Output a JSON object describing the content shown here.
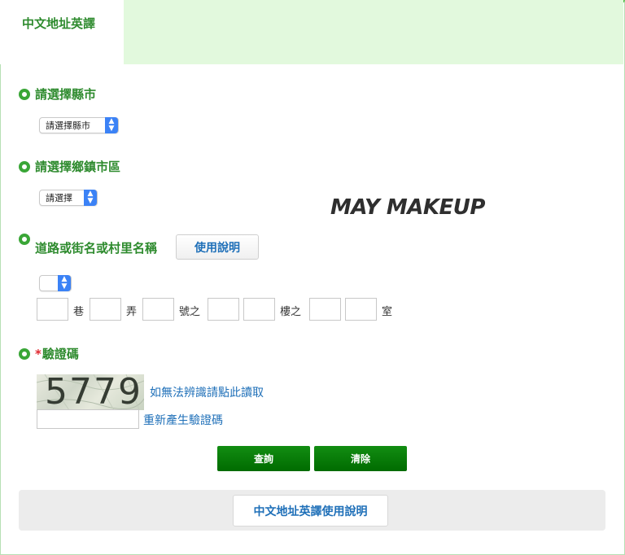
{
  "tab": {
    "label": "中文地址英譯"
  },
  "county": {
    "title": "請選擇縣市",
    "selected": "請選擇縣市"
  },
  "district": {
    "title": "請選擇鄉鎮市區",
    "selected": "請選擇"
  },
  "road": {
    "title": "道路或街名或村里名稱",
    "guide_label": "使用說明",
    "selected": ""
  },
  "address_labels": {
    "lane": "巷",
    "alley": "弄",
    "number": "號之",
    "floor": "樓之",
    "room": "室"
  },
  "captcha": {
    "title": "驗證碼",
    "required_mark": "*",
    "code": "5779",
    "audio_link": "如無法辨識請點此讀取",
    "refresh_link": "重新產生驗證碼",
    "input_value": ""
  },
  "actions": {
    "query_label": "查詢",
    "clear_label": "清除"
  },
  "footer": {
    "help_label": "中文地址英譯使用說明"
  },
  "banner": {
    "logo_text": "MAY MAKEUP"
  },
  "colors": {
    "accent_green": "#3aa637",
    "button_green": "#0a7d0a",
    "link_blue": "#1e6fb8",
    "tab_bg": "#e2f9dd"
  }
}
